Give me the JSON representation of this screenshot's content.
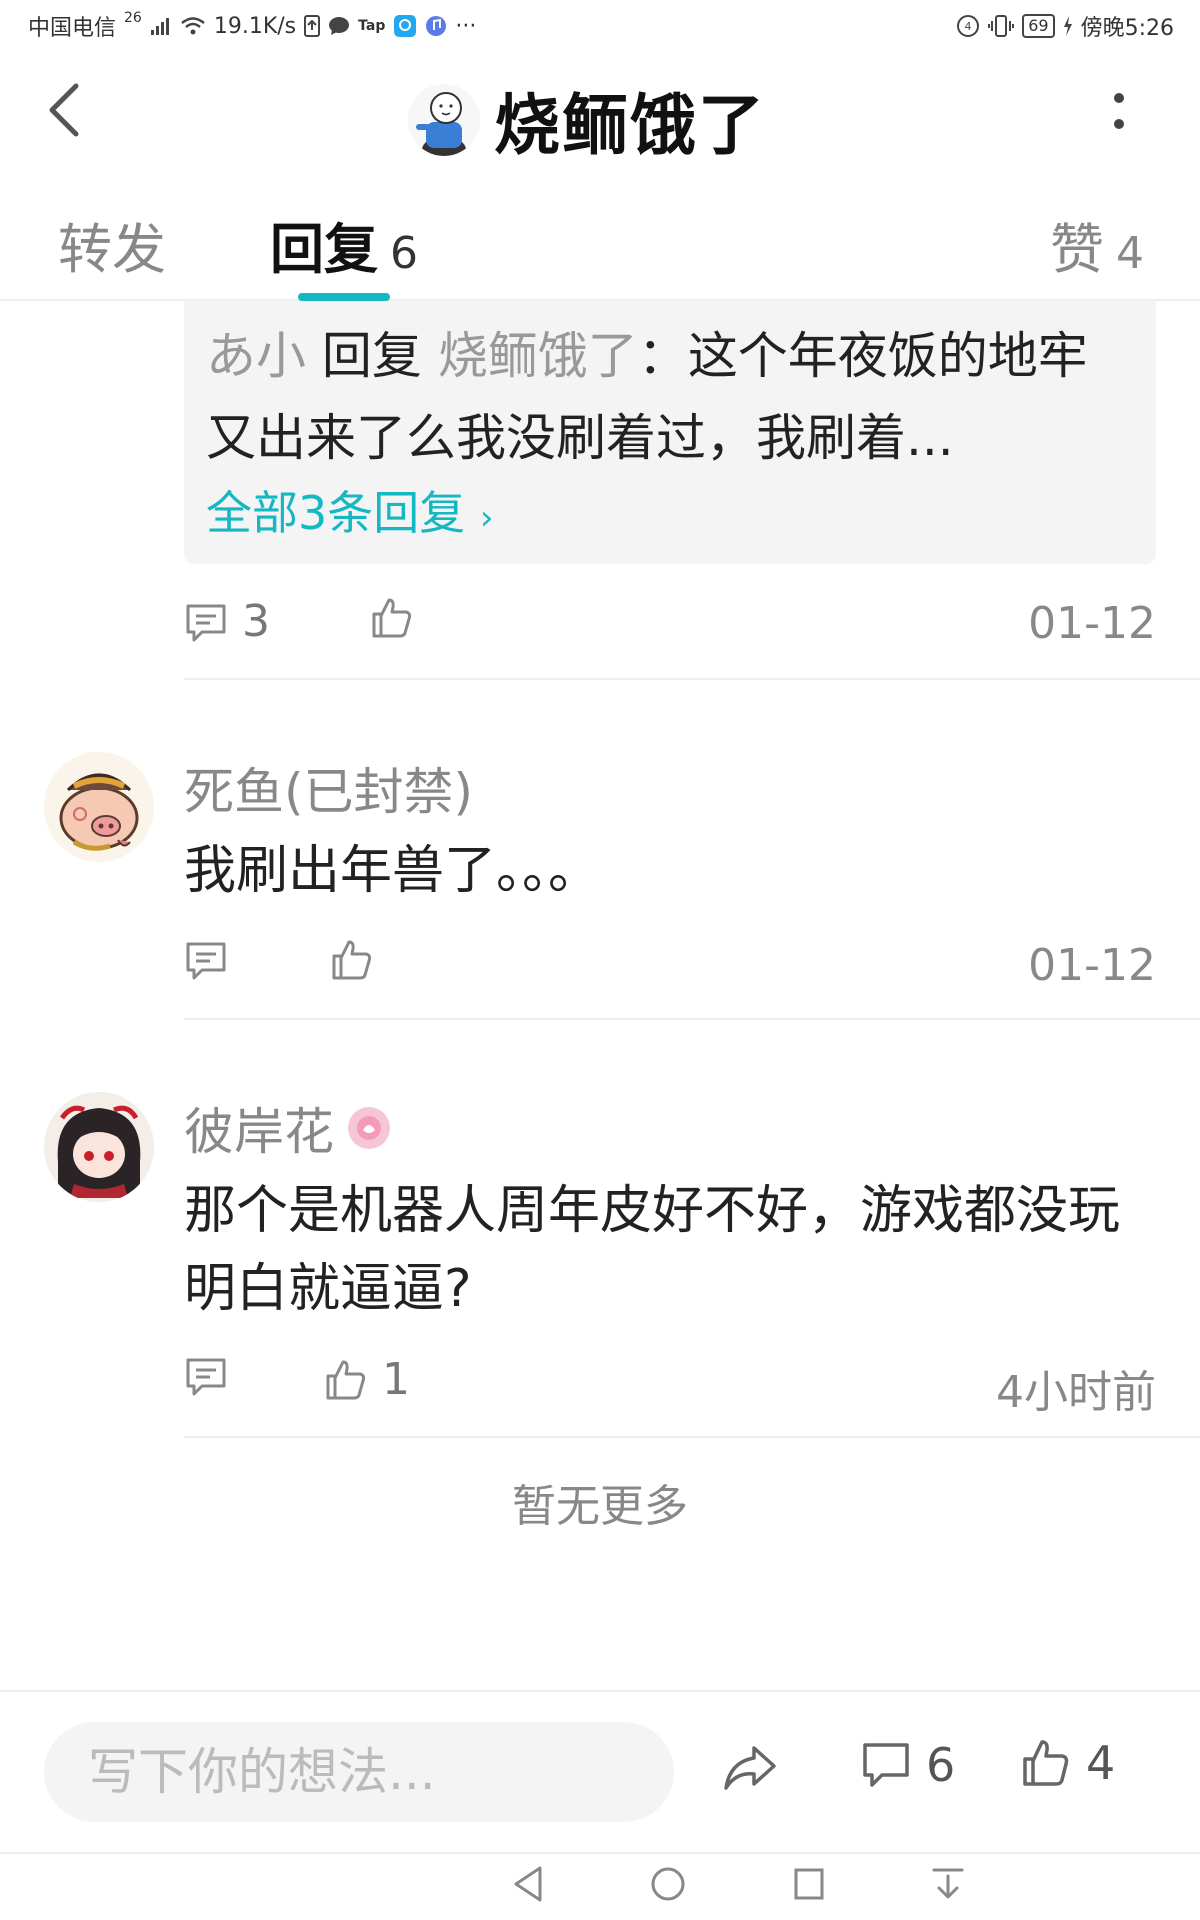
{
  "status_bar": {
    "carrier": "中国电信",
    "network": "26",
    "speed": "19.1K/s",
    "app_tag": "Tap",
    "more": "···",
    "battery": "69",
    "time": "傍晚5:26"
  },
  "header": {
    "title": "烧鲕饿了"
  },
  "tabs": [
    {
      "label": "转发",
      "count": ""
    },
    {
      "label": "回复",
      "count": "6"
    },
    {
      "label": "赞",
      "count": "4"
    }
  ],
  "comments": [
    {
      "reply_preview": {
        "user": "あ小",
        "verb": "回复",
        "target": "烧鲕饿了",
        "sep": "：",
        "text": "这个年夜饭的地牢又出来了么我没刷着过，我刷着...",
        "more_label": "全部3条回复"
      },
      "reply_count": "3",
      "like_count": "",
      "time": "01-12"
    },
    {
      "name": "死鱼(已封禁)",
      "body": "我刷出年兽了。。。",
      "reply_count": "",
      "like_count": "",
      "time": "01-12"
    },
    {
      "name": "彼岸花",
      "body": "那个是机器人周年皮好不好，游戏都没玩明白就逼逼?",
      "reply_count": "",
      "like_count": "1",
      "time": "4小时前"
    }
  ],
  "footer_note": "暂无更多",
  "bottom_bar": {
    "input_placeholder": "写下你的想法...",
    "comment_count": "6",
    "like_count": "4"
  },
  "icons": {
    "accent_color": "#14b8c3",
    "back": "chevron-left-icon",
    "more": "more-vertical-icon",
    "reply": "comment-icon",
    "like": "thumbs-up-icon",
    "share": "share-icon"
  }
}
